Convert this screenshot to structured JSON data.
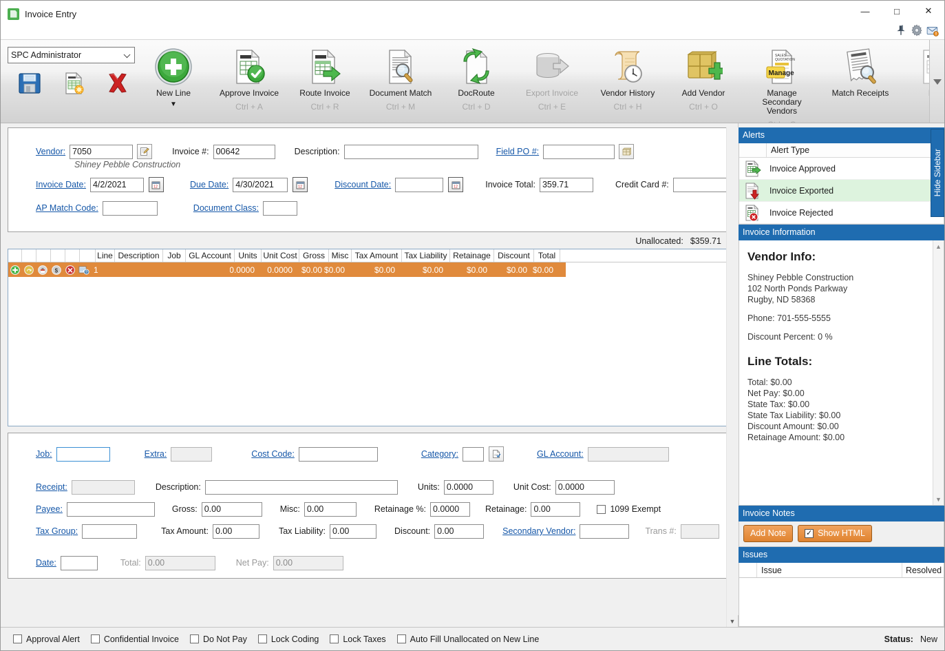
{
  "window": {
    "title": "Invoice Entry",
    "app_icon": "invoice-app-icon",
    "minimize": "—",
    "maximize": "□",
    "close": "✕",
    "tools": [
      "pin-icon",
      "gear-icon",
      "mail-alert-icon"
    ]
  },
  "ribbon": {
    "user": "SPC Administrator",
    "quick_buttons": [
      {
        "name": "save-button",
        "icon": "floppy-disk-icon"
      },
      {
        "name": "new-invoice-button",
        "icon": "invoice-new-icon"
      },
      {
        "name": "delete-button",
        "icon": "red-x-icon"
      }
    ],
    "items": [
      {
        "label": "New Line",
        "key": "",
        "icon": "green-plus-circle-icon",
        "disabled": false,
        "dropdown": true
      },
      {
        "label": "Approve Invoice",
        "key": "Ctrl + A",
        "icon": "invoice-check-icon",
        "disabled": false
      },
      {
        "label": "Route Invoice",
        "key": "Ctrl + R",
        "icon": "invoice-arrow-icon",
        "disabled": false
      },
      {
        "label": "Document Match",
        "key": "Ctrl + M",
        "icon": "document-magnifier-icon",
        "disabled": false
      },
      {
        "label": "DocRoute",
        "key": "Ctrl + D",
        "icon": "doc-recycle-icon",
        "disabled": false
      },
      {
        "label": "Export Invoice",
        "key": "Ctrl + E",
        "icon": "database-export-icon",
        "disabled": true
      },
      {
        "label": "Vendor History",
        "key": "Ctrl + H",
        "icon": "scroll-clock-icon",
        "disabled": false
      },
      {
        "label": "Add Vendor",
        "key": "Ctrl + O",
        "icon": "box-plus-icon",
        "disabled": false
      },
      {
        "label": "Manage Secondary Vendors",
        "key": "Ctrl + G",
        "icon": "quotation-note-icon",
        "disabled": false
      },
      {
        "label": "Match Receipts",
        "key": "",
        "icon": "receipt-magnifier-icon",
        "disabled": false
      },
      {
        "label": "Invo",
        "key": "",
        "icon": "invoice-clipped-icon",
        "disabled": true
      }
    ],
    "overflow_icon": "chevron-down-icon"
  },
  "header_form": {
    "vendor_label": "Vendor:",
    "vendor_value": "7050",
    "vendor_picker_icon": "notepad-pencil-icon",
    "vendor_name": "Shiney Pebble Construction",
    "invoice_no_label": "Invoice #:",
    "invoice_no_value": "00642",
    "description_label": "Description:",
    "description_value": "",
    "field_po_label": "Field PO #:",
    "field_po_value": "",
    "field_po_picker_icon": "box-picker-icon",
    "invoice_date_label": "Invoice Date:",
    "invoice_date_value": "4/2/2021",
    "due_date_label": "Due Date:",
    "due_date_value": "4/30/2021",
    "discount_date_label": "Discount Date:",
    "discount_date_value": "",
    "invoice_total_label": "Invoice Total:",
    "invoice_total_value": "359.71",
    "credit_card_label": "Credit Card #:",
    "credit_card_value": "",
    "ap_match_label": "AP Match Code:",
    "ap_match_value": "",
    "document_class_label": "Document Class:",
    "document_class_value": "",
    "calendar_icon": "calendar-icon"
  },
  "unallocated": {
    "label": "Unallocated:",
    "value": "$359.71"
  },
  "grid": {
    "row_icons": [
      "add-row-icon",
      "copy-row-icon",
      "paste-row-icon",
      "allocate-dollar-icon",
      "delete-row-icon",
      "row-help-icon"
    ],
    "columns": [
      "Line",
      "Description",
      "Job",
      "GL Account",
      "Units",
      "Unit Cost",
      "Gross",
      "Misc",
      "Tax Amount",
      "Tax Liability",
      "Retainage",
      "Discount",
      "Total"
    ],
    "rows": [
      {
        "Line": "1",
        "Description": "",
        "Job": "",
        "GL Account": "",
        "Units": "0.0000",
        "Unit Cost": "0.0000",
        "Gross": "$0.00",
        "Misc": "$0.00",
        "Tax Amount": "$0.00",
        "Tax Liability": "$0.00",
        "Retainage": "$0.00",
        "Discount": "$0.00",
        "Total": "$0.00"
      }
    ]
  },
  "detail_form": {
    "job_label": "Job:",
    "job_value": "",
    "extra_label": "Extra:",
    "extra_value": "",
    "cost_code_label": "Cost Code:",
    "cost_code_value": "",
    "category_label": "Category:",
    "category_value": "",
    "category_picker_icon": "document-picker-icon",
    "gl_account_label": "GL Account:",
    "gl_account_value": "",
    "receipt_label": "Receipt:",
    "receipt_value": "",
    "description_label": "Description:",
    "description_value": "",
    "units_label": "Units:",
    "units_value": "0.0000",
    "unit_cost_label": "Unit Cost:",
    "unit_cost_value": "0.0000",
    "payee_label": "Payee:",
    "payee_value": "",
    "gross_label": "Gross:",
    "gross_value": "0.00",
    "misc_label": "Misc:",
    "misc_value": "0.00",
    "retainage_pct_label": "Retainage %:",
    "retainage_pct_value": "0.0000",
    "retainage_label": "Retainage:",
    "retainage_value": "0.00",
    "exempt_1099_label": "1099 Exempt",
    "tax_group_label": "Tax Group:",
    "tax_group_value": "",
    "tax_amount_label": "Tax Amount:",
    "tax_amount_value": "0.00",
    "tax_liability_label": "Tax Liability:",
    "tax_liability_value": "0.00",
    "discount_label": "Discount:",
    "discount_value": "0.00",
    "secondary_vendor_label": "Secondary Vendor:",
    "secondary_vendor_value": "",
    "trans_no_label": "Trans #:",
    "trans_no_value": "",
    "date_label": "Date:",
    "date_value": "",
    "total_label": "Total:",
    "total_value": "0.00",
    "net_pay_label": "Net Pay:",
    "net_pay_value": "0.00"
  },
  "sidebar": {
    "hide_label": "Hide Sidebar",
    "alerts": {
      "title": "Alerts",
      "column_header": "Alert Type",
      "rows": [
        {
          "label": "Invoice Approved",
          "icon": "invoice-green-arrow-icon",
          "selected": false
        },
        {
          "label": "Invoice Exported",
          "icon": "invoice-red-down-arrow-icon",
          "selected": true
        },
        {
          "label": "Invoice Rejected",
          "icon": "invoice-red-x-icon",
          "selected": false
        }
      ]
    },
    "invoice_information": {
      "title": "Invoice Information",
      "vendor_heading": "Vendor Info:",
      "vendor_lines": [
        "Shiney Pebble Construction",
        "102 North Ponds Parkway",
        "Rugby, ND 58368"
      ],
      "phone": "Phone: 701-555-5555",
      "discount_percent": "Discount Percent: 0 %",
      "totals_heading": "Line Totals:",
      "totals": [
        "Total:  $0.00",
        "Net Pay:  $0.00",
        "State Tax:  $0.00",
        "State Tax Liability:  $0.00",
        "Discount Amount:  $0.00",
        "Retainage Amount:  $0.00"
      ]
    },
    "invoice_notes": {
      "title": "Invoice Notes",
      "add_note": "Add Note",
      "show_html": "Show HTML",
      "show_html_checked": true
    },
    "issues": {
      "title": "Issues",
      "columns": [
        "Issue",
        "Resolved"
      ]
    }
  },
  "statusbar": {
    "checkboxes": [
      {
        "label": "Approval Alert",
        "checked": false
      },
      {
        "label": "Confidential Invoice",
        "checked": false
      },
      {
        "label": "Do Not Pay",
        "checked": false
      },
      {
        "label": "Lock Coding",
        "checked": false
      },
      {
        "label": "Lock Taxes",
        "checked": false
      },
      {
        "label": "Auto Fill Unallocated on New Line",
        "checked": false
      }
    ],
    "status_label": "Status:",
    "status_value": "New"
  },
  "colors": {
    "accent_blue": "#1f6cb0",
    "row_orange": "#e08a3c",
    "link_blue": "#1557a8",
    "selected_green": "#ddf3de"
  }
}
